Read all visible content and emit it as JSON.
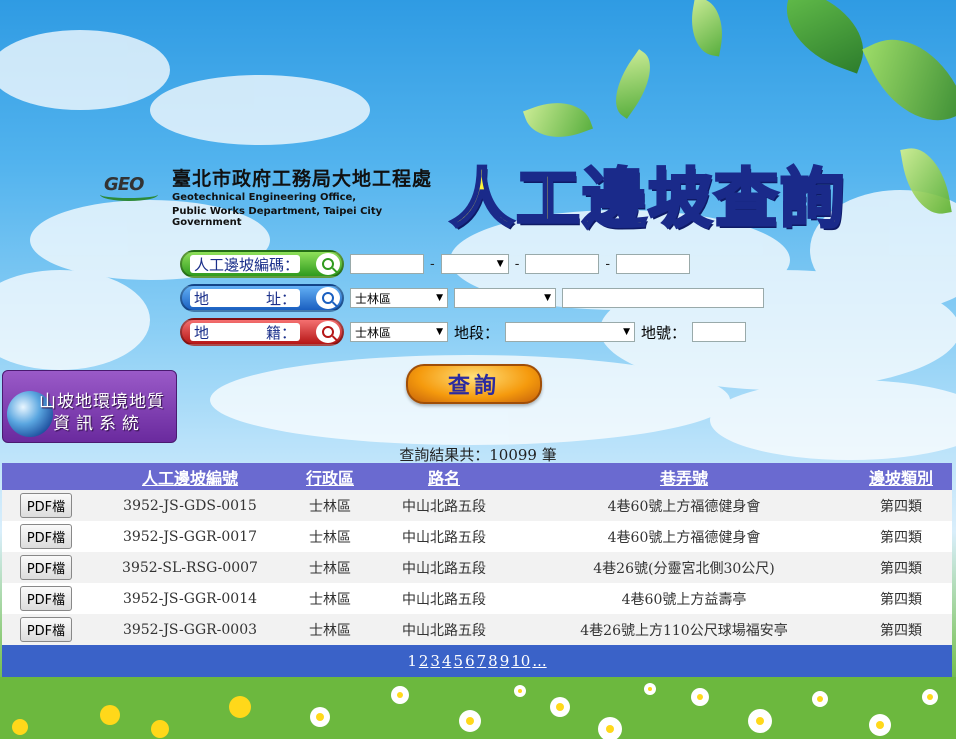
{
  "header": {
    "agency_cn": "臺北市政府工務局大地工程處",
    "agency_en_1": "Geotechnical Engineering Office,",
    "agency_en_2": "Public Works Department, Taipei City Government",
    "logo_mark": "GEO",
    "page_title": "人工邊坡查詢"
  },
  "search": {
    "code_label": "人工邊坡編碼：",
    "address_label_1": "地",
    "address_label_2": "址：",
    "land_label_1": "地",
    "land_label_2": "籍：",
    "address_district": "士林區",
    "land_district": "士林區",
    "section_label": "地段：",
    "number_label": "地號：",
    "dash": "-",
    "query_button": "查詢"
  },
  "side_banner": {
    "line1": "山坡地環境地質",
    "line2": "資訊系統"
  },
  "results": {
    "count_text": "查詢結果共：10099 筆",
    "columns": [
      "",
      "人工邊坡編號",
      "行政區",
      "路名",
      "巷弄號",
      "邊坡類別"
    ],
    "pdf_label": "PDF檔",
    "rows": [
      {
        "id": "3952-JS-GDS-0015",
        "district": "士林區",
        "road": "中山北路五段",
        "lane": "4巷60號上方福德健身會",
        "category": "第四類"
      },
      {
        "id": "3952-JS-GGR-0017",
        "district": "士林區",
        "road": "中山北路五段",
        "lane": "4巷60號上方福德健身會",
        "category": "第四類"
      },
      {
        "id": "3952-SL-RSG-0007",
        "district": "士林區",
        "road": "中山北路五段",
        "lane": "4巷26號(分靈宮北側30公尺)",
        "category": "第四類"
      },
      {
        "id": "3952-JS-GGR-0014",
        "district": "士林區",
        "road": "中山北路五段",
        "lane": "4巷60號上方益壽亭",
        "category": "第四類"
      },
      {
        "id": "3952-JS-GGR-0003",
        "district": "士林區",
        "road": "中山北路五段",
        "lane": "4巷26號上方110公尺球場福安亭",
        "category": "第四類"
      }
    ],
    "pager": {
      "current": "1",
      "pages": [
        "2",
        "3",
        "4",
        "5",
        "6",
        "7",
        "8",
        "9",
        "10",
        "..."
      ]
    }
  }
}
